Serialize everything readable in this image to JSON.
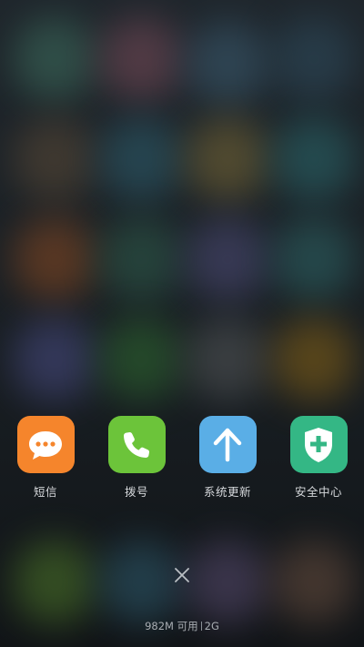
{
  "recent_apps": [
    {
      "label": "短信",
      "icon": "message-bubble-icon",
      "color": "#f5852c"
    },
    {
      "label": "拨号",
      "icon": "phone-icon",
      "color": "#6cc43a"
    },
    {
      "label": "系统更新",
      "icon": "arrow-up-icon",
      "color": "#5aaee6"
    },
    {
      "label": "安全中心",
      "icon": "shield-plus-icon",
      "color": "#34b785"
    }
  ],
  "close_button": {
    "icon": "close-icon"
  },
  "memory": {
    "available": "982M 可用",
    "network": "2G"
  }
}
